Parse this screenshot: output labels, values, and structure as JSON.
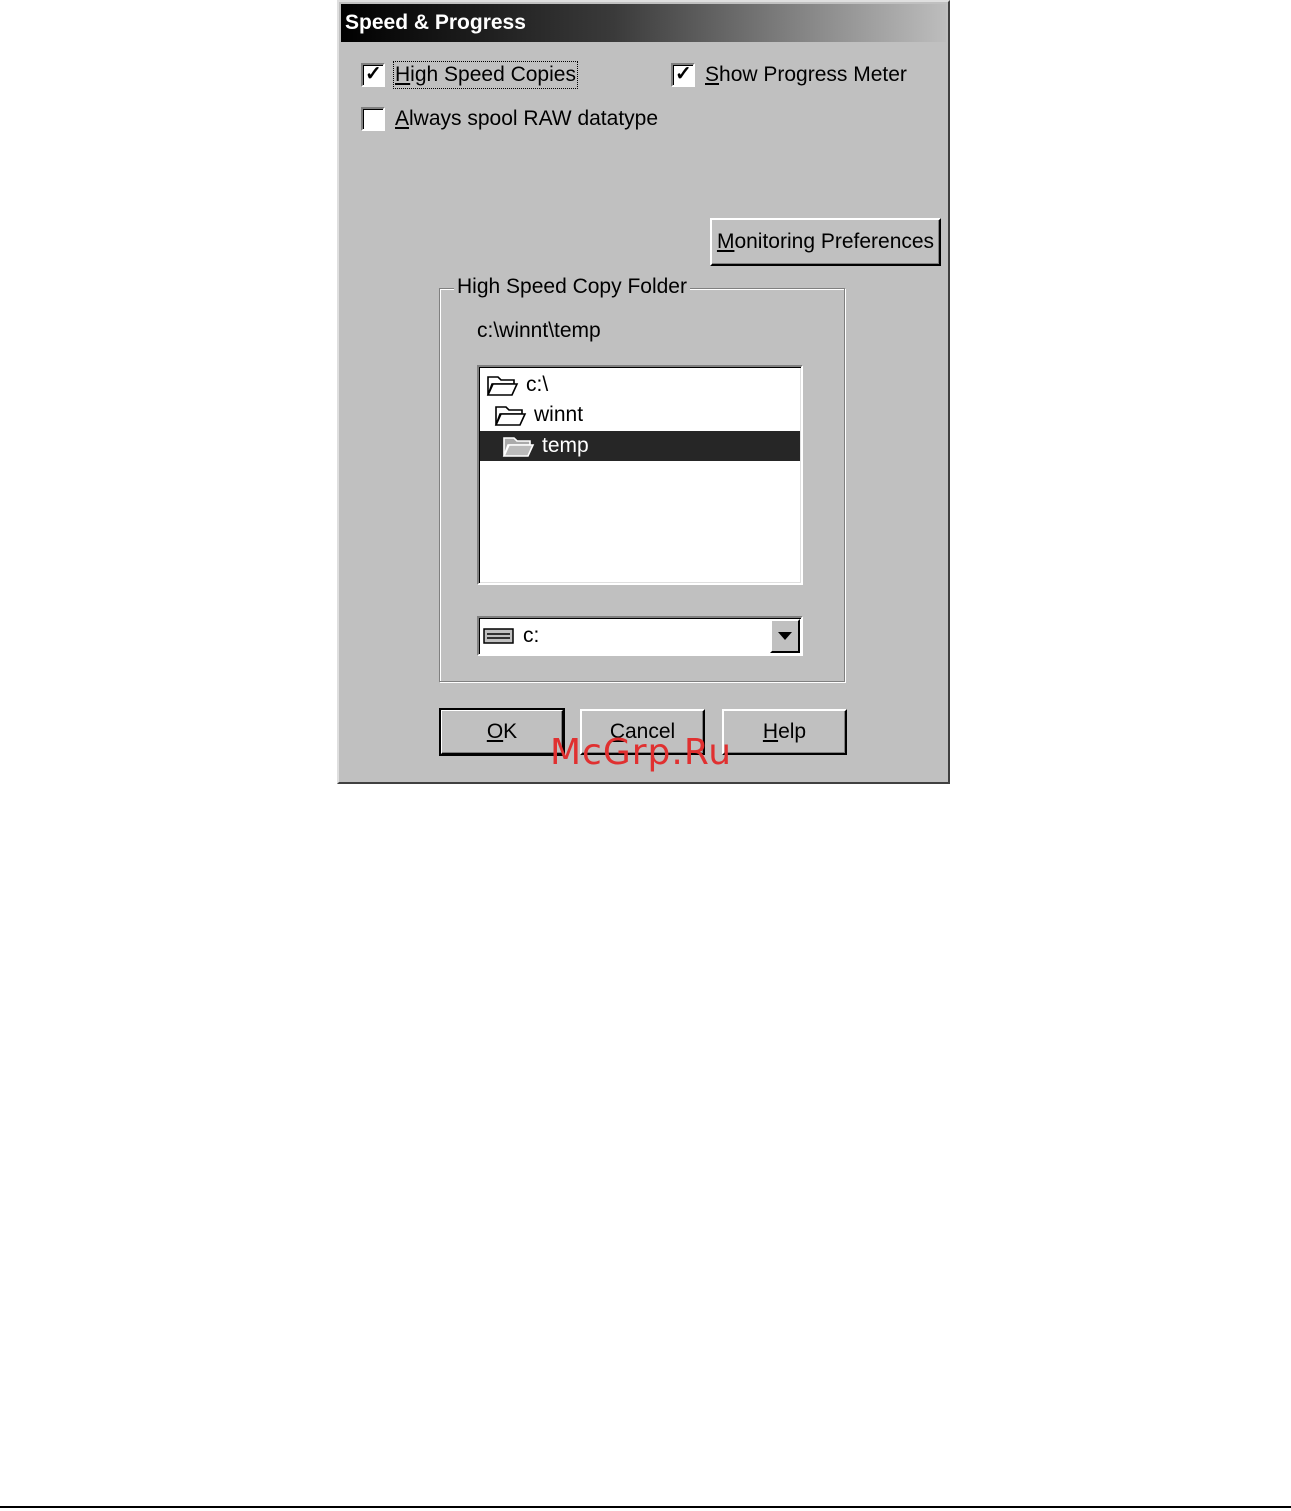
{
  "dialog": {
    "title": "Speed & Progress"
  },
  "options": {
    "high_speed_copies": {
      "label_prefix": "",
      "label_underlined": "H",
      "label_rest": "igh Speed Copies",
      "checked": true
    },
    "show_progress_meter": {
      "label_prefix": "",
      "label_underlined": "S",
      "label_rest": "how Progress Meter",
      "checked": true
    },
    "always_spool_raw": {
      "label_prefix": "",
      "label_underlined": "A",
      "label_rest": "lways spool RAW datatype",
      "checked": false
    }
  },
  "monitoring_button": {
    "label_underlined": "M",
    "label_rest": "onitoring Preferences"
  },
  "folder_group": {
    "legend": "High Speed Copy Folder",
    "current_path": "c:\\winnt\\temp",
    "folders": [
      {
        "name": "c:\\",
        "selected": false
      },
      {
        "name": "winnt",
        "selected": false
      },
      {
        "name": "temp",
        "selected": true
      }
    ],
    "drive_value": "c:"
  },
  "buttons": {
    "ok": {
      "label_underlined": "O",
      "label_rest": "K"
    },
    "cancel": {
      "label_underlined": "C",
      "label_rest": "ancel"
    },
    "help": {
      "label_underlined": "H",
      "label_rest": "elp"
    }
  },
  "watermark": {
    "text": "McGrp.Ru",
    "color": "#e03030"
  },
  "colors": {
    "dialog_face": "#c0c0c0",
    "selection": "#262626"
  }
}
